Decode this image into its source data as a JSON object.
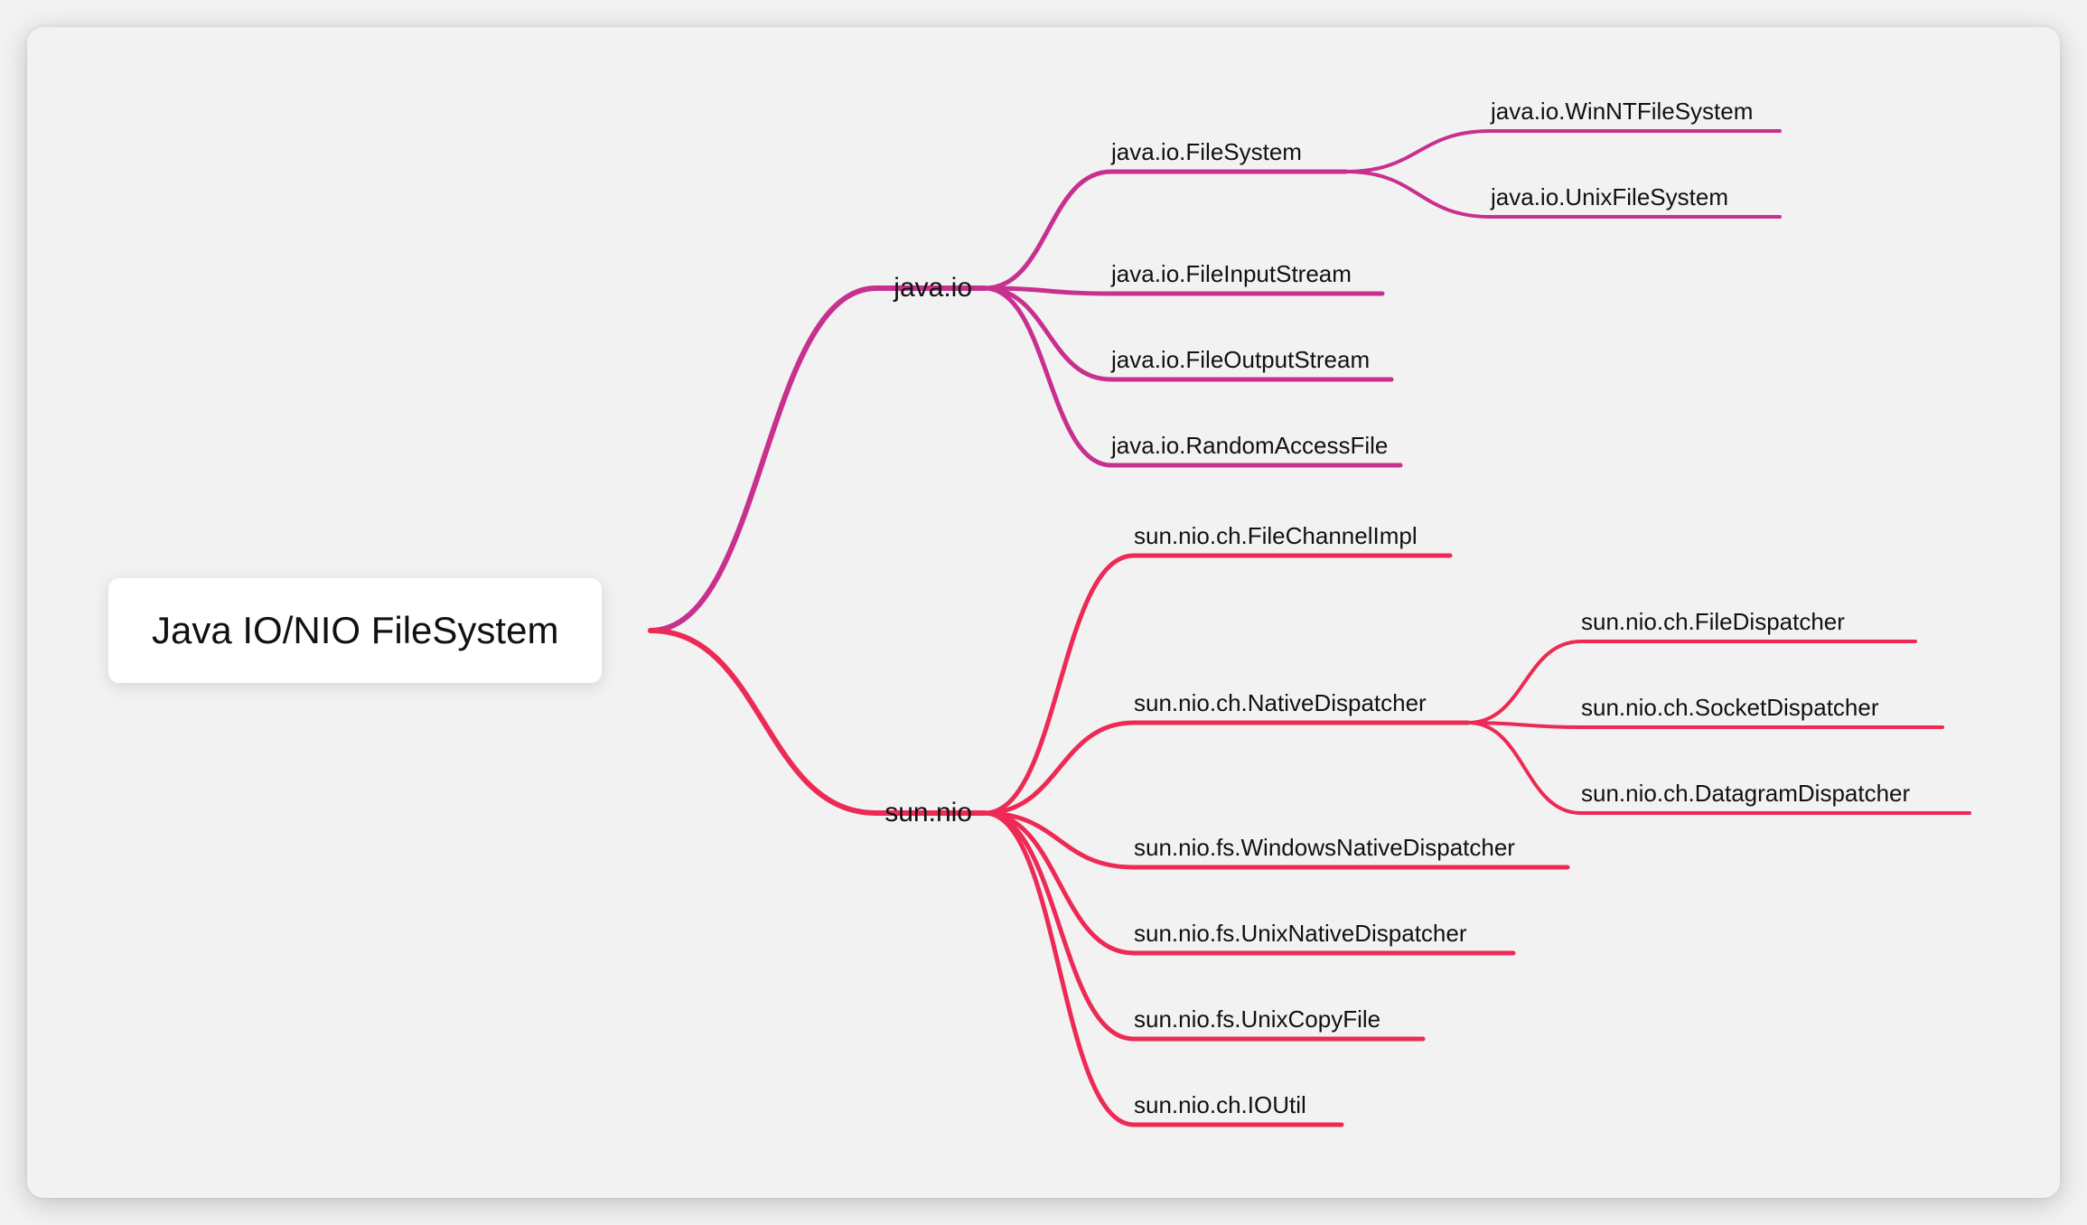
{
  "root": {
    "label": "Java IO/NIO FileSystem"
  },
  "colors": {
    "io": "#c8308f",
    "nio": "#ed2a55"
  },
  "branches": [
    {
      "id": "io",
      "label": "java.io"
    },
    {
      "id": "nio",
      "label": "sun.nio"
    }
  ],
  "nodes": {
    "io": [
      {
        "label": "java.io.FileSystem",
        "children": [
          {
            "label": "java.io.WinNTFileSystem"
          },
          {
            "label": "java.io.UnixFileSystem"
          }
        ]
      },
      {
        "label": "java.io.FileInputStream"
      },
      {
        "label": "java.io.FileOutputStream"
      },
      {
        "label": "java.io.RandomAccessFile"
      }
    ],
    "nio": [
      {
        "label": "sun.nio.ch.FileChannelImpl"
      },
      {
        "label": "sun.nio.ch.NativeDispatcher",
        "children": [
          {
            "label": "sun.nio.ch.FileDispatcher"
          },
          {
            "label": "sun.nio.ch.SocketDispatcher"
          },
          {
            "label": "sun.nio.ch.DatagramDispatcher"
          }
        ]
      },
      {
        "label": "sun.nio.fs.WindowsNativeDispatcher"
      },
      {
        "label": "sun.nio.fs.UnixNativeDispatcher"
      },
      {
        "label": "sun.nio.fs.UnixCopyFile"
      },
      {
        "label": "sun.nio.ch.IOUtil"
      }
    ]
  },
  "chart_data": {
    "type": "mindmap",
    "root": "Java IO/NIO FileSystem",
    "children": [
      {
        "name": "java.io",
        "color": "#c8308f",
        "children": [
          {
            "name": "java.io.FileSystem",
            "children": [
              {
                "name": "java.io.WinNTFileSystem"
              },
              {
                "name": "java.io.UnixFileSystem"
              }
            ]
          },
          {
            "name": "java.io.FileInputStream"
          },
          {
            "name": "java.io.FileOutputStream"
          },
          {
            "name": "java.io.RandomAccessFile"
          }
        ]
      },
      {
        "name": "sun.nio",
        "color": "#ed2a55",
        "children": [
          {
            "name": "sun.nio.ch.FileChannelImpl"
          },
          {
            "name": "sun.nio.ch.NativeDispatcher",
            "children": [
              {
                "name": "sun.nio.ch.FileDispatcher"
              },
              {
                "name": "sun.nio.ch.SocketDispatcher"
              },
              {
                "name": "sun.nio.ch.DatagramDispatcher"
              }
            ]
          },
          {
            "name": "sun.nio.fs.WindowsNativeDispatcher"
          },
          {
            "name": "sun.nio.fs.UnixNativeDispatcher"
          },
          {
            "name": "sun.nio.fs.UnixCopyFile"
          },
          {
            "name": "sun.nio.ch.IOUtil"
          }
        ]
      }
    ]
  }
}
